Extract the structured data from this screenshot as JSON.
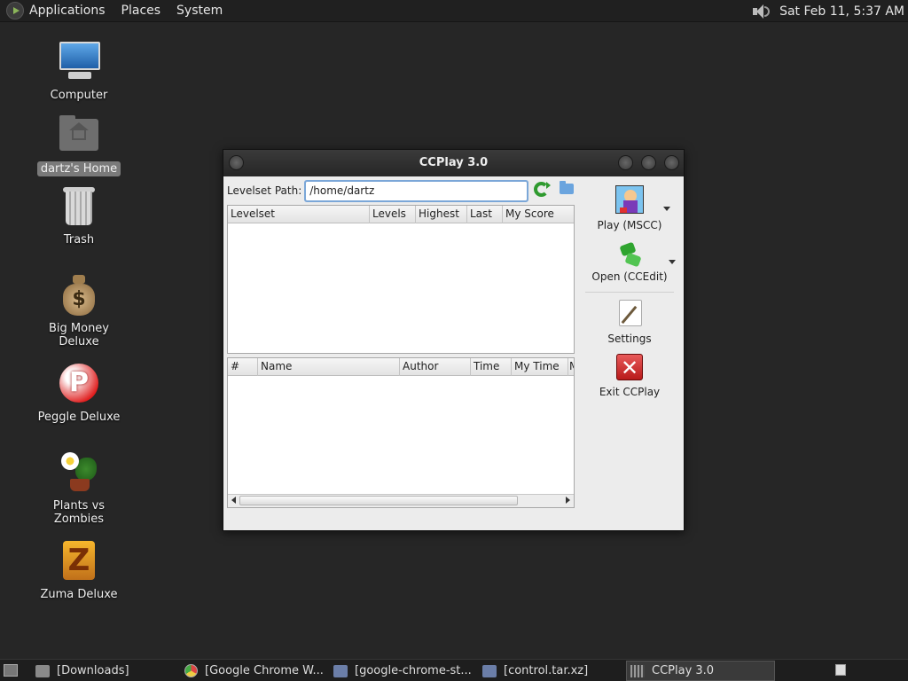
{
  "top_panel": {
    "menus": [
      "Applications",
      "Places",
      "System"
    ],
    "clock": "Sat Feb 11,  5:37 AM"
  },
  "desktop": {
    "icons": [
      {
        "label": "Computer",
        "icon": "computer-icon"
      },
      {
        "label": "dartz's Home",
        "icon": "home-folder-icon",
        "selected": true
      },
      {
        "label": "Trash",
        "icon": "trash-icon"
      },
      {
        "label": "Big Money Deluxe",
        "icon": "money-bag-icon"
      },
      {
        "label": "Peggle Deluxe",
        "icon": "peggle-icon"
      },
      {
        "label": "Plants vs Zombies",
        "icon": "plants-icon"
      },
      {
        "label": "Zuma Deluxe",
        "icon": "zuma-icon"
      }
    ]
  },
  "window": {
    "title": "CCPlay 3.0",
    "path_label": "Levelset Path:",
    "path_value": "/home/dartz",
    "levelset_columns": [
      "Levelset",
      "Levels",
      "Highest",
      "Last",
      "My Score"
    ],
    "level_columns": [
      "#",
      "Name",
      "Author",
      "Time",
      "My Time",
      "M"
    ],
    "side_buttons": {
      "play": "Play (MSCC)",
      "open": "Open (CCEdit)",
      "settings": "Settings",
      "exit": "Exit CCPlay"
    }
  },
  "taskbar": {
    "tasks": [
      {
        "label": "[Downloads]",
        "icon": "folder-icon"
      },
      {
        "label": "[Google Chrome W...",
        "icon": "chrome-icon"
      },
      {
        "label": "[google-chrome-st...",
        "icon": "file-icon"
      },
      {
        "label": "[control.tar.xz]",
        "icon": "file-icon"
      },
      {
        "label": "CCPlay 3.0",
        "icon": "app-icon",
        "active": true
      }
    ]
  },
  "colors": {
    "desktop_bg": "#262626",
    "panel_bg": "#202020",
    "window_bg": "#ececec",
    "input_focus": "#7ba7d8"
  }
}
